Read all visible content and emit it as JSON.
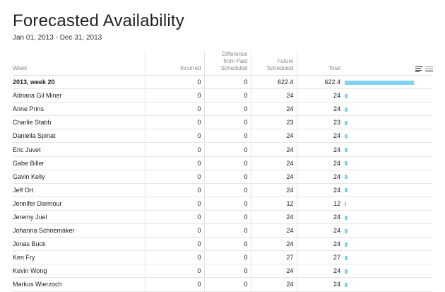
{
  "page": {
    "title": "Forecasted Availability",
    "date_range": "Jan 01, 2013 - Dec 31, 2013"
  },
  "table": {
    "headers": {
      "week": "Week",
      "incurred": "Incurred",
      "difference_l1": "Difference",
      "difference_l2": "from Past",
      "difference_l3": "Scheduled",
      "future_l1": "Future",
      "future_l2": "Scheduled",
      "total": "Total"
    },
    "total_row": {
      "name": "2013, week 20",
      "incurred": "0",
      "difference": "0",
      "future": "622.4",
      "total": "622.4",
      "bar_fraction": 1.0
    },
    "rows": [
      {
        "name": "Adriana Gil Miner",
        "incurred": "0",
        "difference": "0",
        "future": "24",
        "total": "24",
        "bar_fraction": 0.0386
      },
      {
        "name": "Anne Prins",
        "incurred": "0",
        "difference": "0",
        "future": "24",
        "total": "24",
        "bar_fraction": 0.0386
      },
      {
        "name": "Charlie Stabb",
        "incurred": "0",
        "difference": "0",
        "future": "23",
        "total": "23",
        "bar_fraction": 0.037
      },
      {
        "name": "Daniella Spinat",
        "incurred": "0",
        "difference": "0",
        "future": "24",
        "total": "24",
        "bar_fraction": 0.0386
      },
      {
        "name": "Eric Juvet",
        "incurred": "0",
        "difference": "0",
        "future": "24",
        "total": "24",
        "bar_fraction": 0.0386
      },
      {
        "name": "Gabe Biller",
        "incurred": "0",
        "difference": "0",
        "future": "24",
        "total": "24",
        "bar_fraction": 0.0386
      },
      {
        "name": "Gavin Kelly",
        "incurred": "0",
        "difference": "0",
        "future": "24",
        "total": "24",
        "bar_fraction": 0.0386
      },
      {
        "name": "Jeff Ort",
        "incurred": "0",
        "difference": "0",
        "future": "24",
        "total": "24",
        "bar_fraction": 0.0386
      },
      {
        "name": "Jennifer Darmour",
        "incurred": "0",
        "difference": "0",
        "future": "12",
        "total": "12",
        "bar_fraction": 0.0193
      },
      {
        "name": "Jeremy Juel",
        "incurred": "0",
        "difference": "0",
        "future": "24",
        "total": "24",
        "bar_fraction": 0.0386
      },
      {
        "name": "Johanna Schoemaker",
        "incurred": "0",
        "difference": "0",
        "future": "24",
        "total": "24",
        "bar_fraction": 0.0386
      },
      {
        "name": "Jonas Buck",
        "incurred": "0",
        "difference": "0",
        "future": "24",
        "total": "24",
        "bar_fraction": 0.0386
      },
      {
        "name": "Ken Fry",
        "incurred": "0",
        "difference": "0",
        "future": "27",
        "total": "27",
        "bar_fraction": 0.0434
      },
      {
        "name": "Kevin Wong",
        "incurred": "0",
        "difference": "0",
        "future": "24",
        "total": "24",
        "bar_fraction": 0.0386
      },
      {
        "name": "Markus Wierzoch",
        "incurred": "0",
        "difference": "0",
        "future": "24",
        "total": "24",
        "bar_fraction": 0.0386
      }
    ]
  },
  "view_toggle": {
    "icons": [
      "bar-view-icon",
      "list-view-icon"
    ]
  },
  "colors": {
    "bar": "#7fd3f0"
  }
}
